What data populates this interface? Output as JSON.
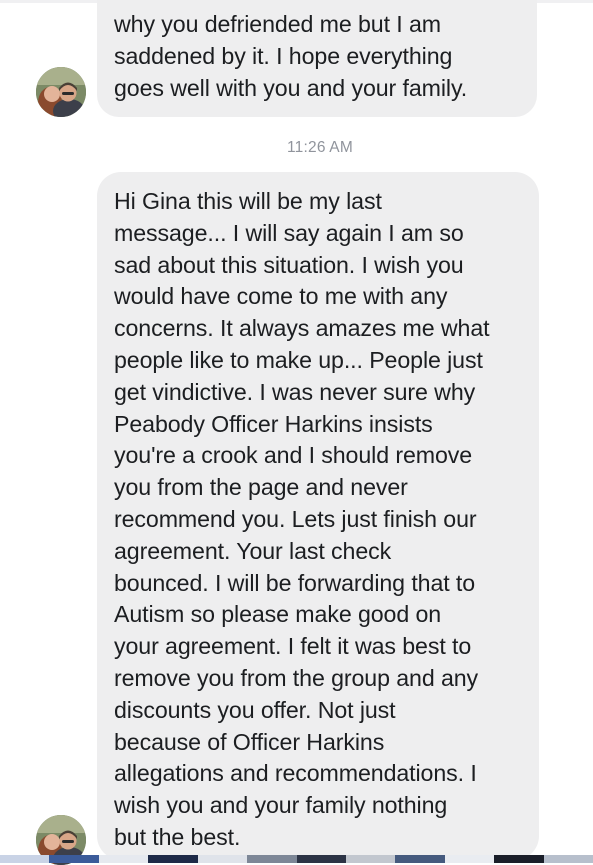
{
  "conversation": {
    "messages": [
      {
        "sender": "them",
        "lines": [
          "why you defriended me but I am",
          "saddened by it. I hope everything",
          "goes well with you and your family."
        ]
      },
      {
        "sender": "them",
        "lines": [
          "Hi Gina this will be my last",
          "message... I will say again I am so",
          "sad about this situation. I wish you",
          "would have come to me with any",
          "concerns. It always amazes me what",
          "people like to make up... People just",
          "get vindictive. I was never sure why",
          "Peabody Officer Harkins insists",
          "you're a crook and I should remove",
          "you from the page and never",
          "recommend you. Lets just finish our",
          "agreement. Your last check",
          "bounced. I will be forwarding that to",
          "Autism so please make good on",
          "your agreement. I felt it was best to",
          "remove you from the group and any",
          "discounts you offer. Not just",
          "because of Officer Harkins",
          "allegations and recommendations.  I",
          "wish you and your family nothing",
          "but the best."
        ]
      }
    ],
    "timestamp": "11:26 AM"
  },
  "colors": {
    "bubble_bg": "#eeeeef",
    "text": "#1c1e21",
    "timestamp": "#90949c"
  },
  "icons": {
    "avatar": "user-avatar-photo"
  }
}
